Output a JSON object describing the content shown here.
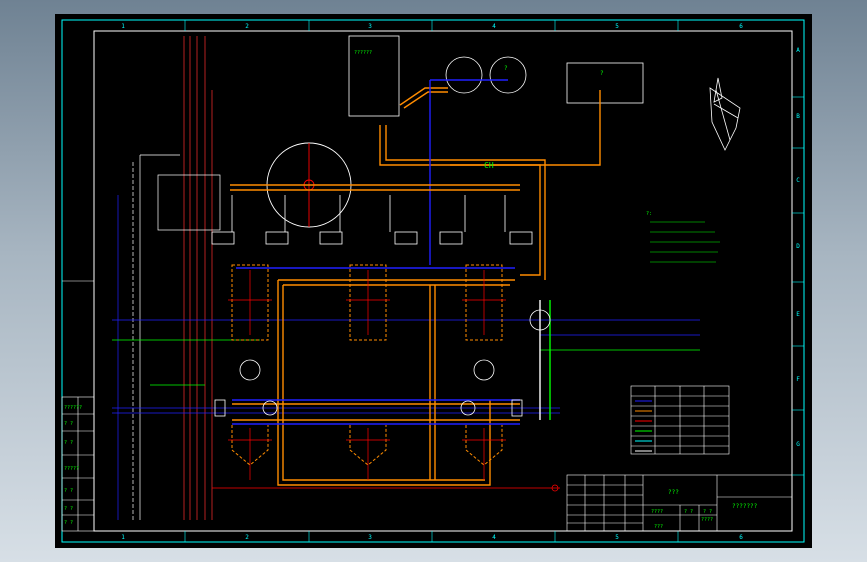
{
  "drawing": {
    "col_labels": [
      "1",
      "2",
      "3",
      "4",
      "5",
      "6"
    ],
    "row_labels": [
      "A",
      "B",
      "C",
      "D",
      "E",
      "F",
      "G"
    ],
    "left_block_texts": [
      "??????",
      "? ?",
      "? ?",
      "?????",
      "? ?",
      "? ?",
      "? ?"
    ],
    "title_block": {
      "title": "???",
      "drawing_name": "???????",
      "number": "????",
      "scale": "? ?",
      "sheet": "? ?",
      "extra": "???",
      "code": "????"
    },
    "room_label": "??????",
    "tower_label": "?",
    "box_label": "?",
    "pipe_label": "CH",
    "notes_title": "?:"
  },
  "colors": {
    "background": "#000000",
    "frame": "#00ffff",
    "green": "#00ff00",
    "red": "#ff0000",
    "blue": "#2020ff",
    "orange": "#ff8c00",
    "white": "#ffffff"
  }
}
